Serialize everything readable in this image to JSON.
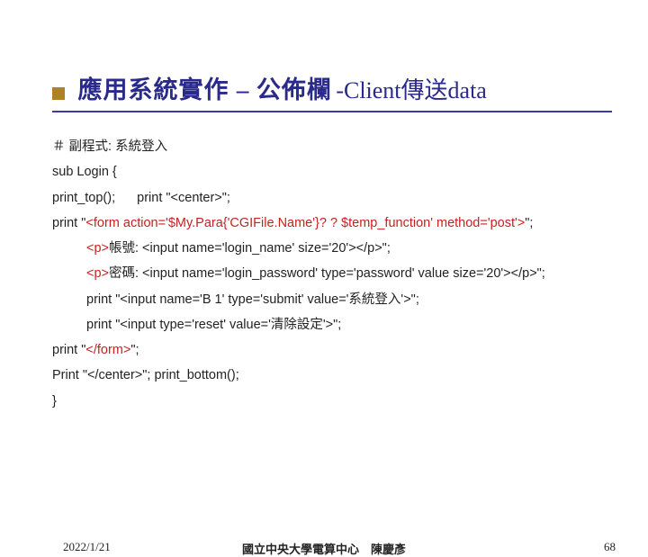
{
  "title": {
    "part1": "應用系統實作",
    "dash": "–",
    "part2": "公佈欄",
    "suffix": "-Client傳送data"
  },
  "code": {
    "l1": "＃ 副程式: 系統登入",
    "l2": "sub Login {",
    "l3a": " print_top();",
    "l3b": "print \"<center>\";",
    "l4a": " print \"",
    "l4b": "<form   action='$My.Para{'CGIFile.Name'}? ? $temp_function' method='post'>",
    "l4c": "\";",
    "l5a": "<p>",
    "l5b": "帳號: <input name='login_name' size='20'></p>\";",
    "l6a": "<p>",
    "l6b": "密碼: <input name='login_password' type='password' value size='20'></p>\";",
    "l7": "print \"<input name='B 1' type='submit' value='系統登入'>\";",
    "l8": "print \"<input type='reset' value='清除設定'>\";",
    "l9a": " print \"",
    "l9b": "</form>",
    "l9c": "\";",
    "l10": " Print \"</center>\"; print_bottom();",
    "l11": "}"
  },
  "footer": {
    "date": "2022/1/21",
    "center": "國立中央大學電算中心　陳慶彥",
    "page": "68"
  }
}
